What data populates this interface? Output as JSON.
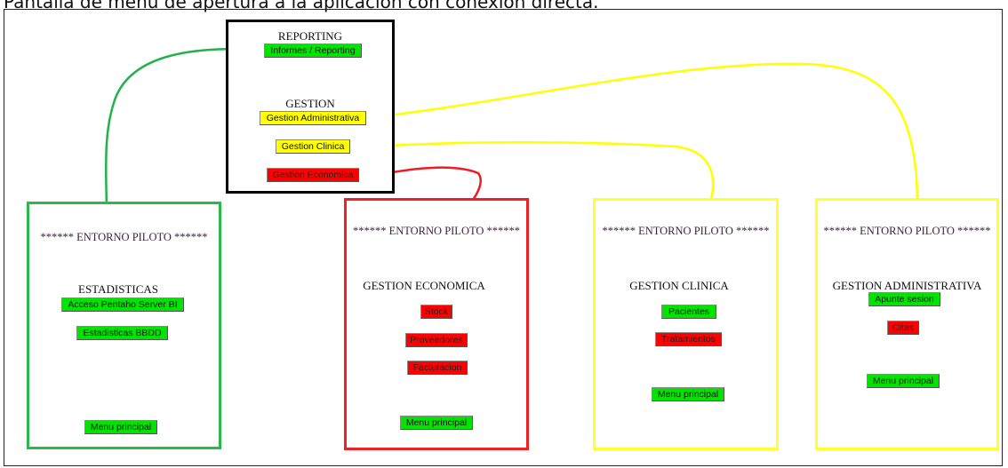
{
  "caption": "Pantalla de menu de apertura a la aplicación con conexión directa.",
  "colors": {
    "green": "#00e400",
    "yellow": "#ffff00",
    "red": "#ff0000",
    "green_border": "#2db84a",
    "yellow_border": "#ffff33",
    "red_border": "#ee2222",
    "menu_border": "#000000"
  },
  "main_menu": {
    "reporting_title": "REPORTING",
    "reporting_button": "Informes / Reporting",
    "gestion_title": "GESTION",
    "gestion_admin_button": "Gestion Administrativa",
    "gestion_clinica_button": "Gestion Clinica",
    "gestion_economica_button": "Gestion Economica"
  },
  "panels": {
    "estadisticas": {
      "header": "****** ENTORNO PILOTO ******",
      "title": "ESTADISTICAS",
      "buttons": [
        "Acceso Pentaho Server BI",
        "Estadisticas BBDD"
      ],
      "menu_button": "Menu principal"
    },
    "economica": {
      "header": "****** ENTORNO PILOTO ******",
      "title": "GESTION ECONOMICA",
      "buttons": [
        "Stock",
        "Proveedores",
        "Facturacion"
      ],
      "menu_button": "Menu principal"
    },
    "clinica": {
      "header": "****** ENTORNO PILOTO ******",
      "title": "GESTION CLINICA",
      "buttons": [
        "Pacientes",
        "Tratamientos"
      ],
      "menu_button": "Menu principal"
    },
    "administrativa": {
      "header": "****** ENTORNO PILOTO ******",
      "title": "GESTION ADMINISTRATIVA",
      "buttons": [
        "Apunte sesion",
        "Citas"
      ],
      "menu_button": "Menu principal"
    }
  }
}
